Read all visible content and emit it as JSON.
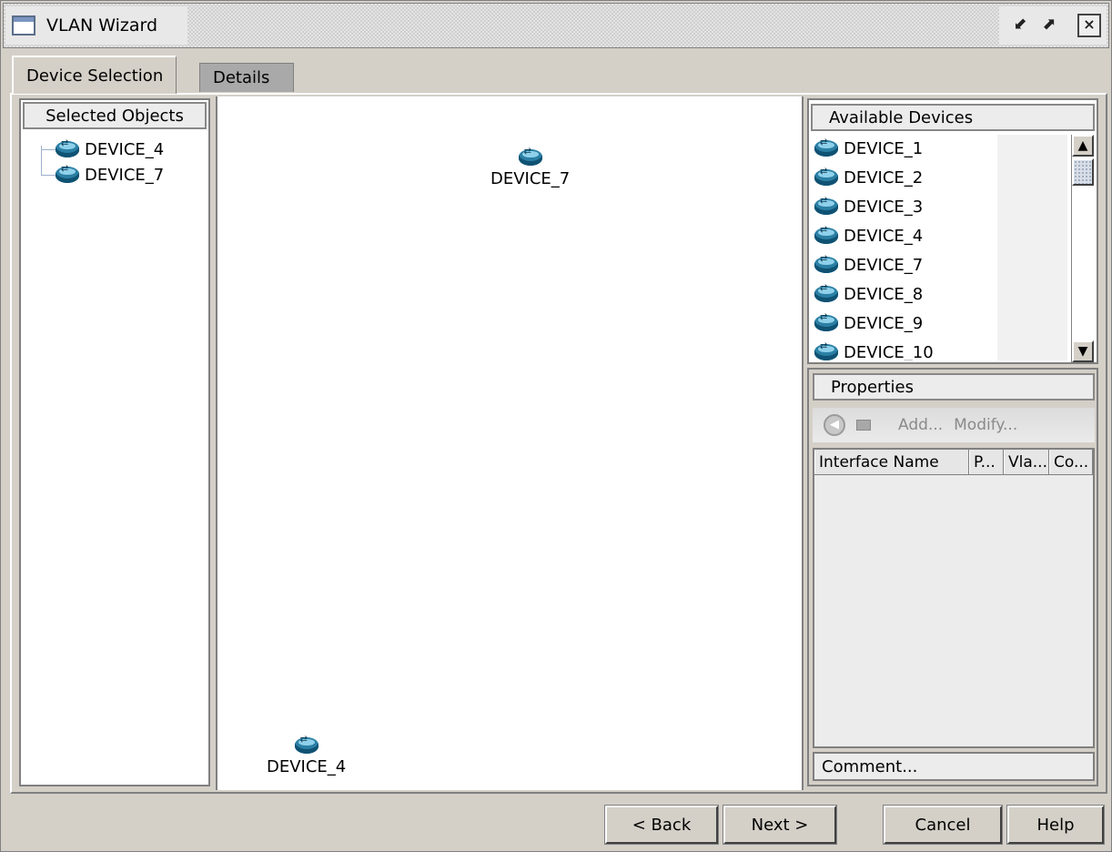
{
  "window": {
    "title": "VLAN Wizard"
  },
  "tabs": [
    {
      "label": "Device Selection"
    },
    {
      "label": "Details"
    }
  ],
  "selected_objects": {
    "header": "Selected Objects",
    "items": [
      "DEVICE_4",
      "DEVICE_7"
    ]
  },
  "canvas": {
    "nodes": [
      "DEVICE_7",
      "DEVICE_4"
    ]
  },
  "available_devices": {
    "header": "Available Devices",
    "items": [
      "DEVICE_1",
      "DEVICE_2",
      "DEVICE_3",
      "DEVICE_4",
      "DEVICE_7",
      "DEVICE_8",
      "DEVICE_9",
      "DEVICE_10"
    ]
  },
  "properties": {
    "header": "Properties",
    "add_label": "Add...",
    "modify_label": "Modify...",
    "columns": [
      "Interface Name",
      "P...",
      "Vla...",
      "Co..."
    ],
    "comment_label": "Comment..."
  },
  "buttons": {
    "back": "< Back",
    "next": "Next >",
    "cancel": "Cancel",
    "help": "Help"
  },
  "icons": {
    "window": "window-icon",
    "device": "router-icon",
    "float": "float-window-icon",
    "maximize": "maximize-icon",
    "close": "close-icon"
  },
  "colors": {
    "router_body": "#2b7fa4",
    "window_bg": "#d4d0c8"
  }
}
